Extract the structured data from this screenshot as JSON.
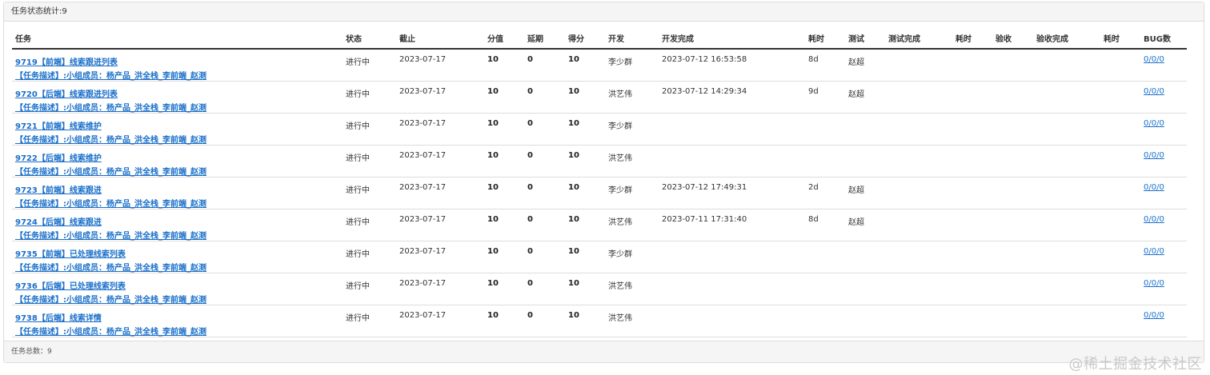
{
  "panel": {
    "header": "任务状态统计:9",
    "footer": "任务总数：9"
  },
  "table": {
    "headers": [
      "任务",
      "状态",
      "截止",
      "分值",
      "延期",
      "得分",
      "开发",
      "开发完成",
      "耗时",
      "测试",
      "测试完成",
      "耗时",
      "验收",
      "验收完成",
      "耗时",
      "BUG数"
    ],
    "rows": [
      {
        "title": "9719【前端】线索跟进列表",
        "desc": "【任务描述】:小组成员：杨产品_洪全栈_李前端_赵测",
        "status": "进行中",
        "deadline": "2023-07-17",
        "score": "10",
        "delay": "0",
        "points": "10",
        "dev": "李少群",
        "dev_done": "2023-07-12 16:53:58",
        "dev_time": "8d",
        "tester": "赵超",
        "test_done": "",
        "test_time": "",
        "accept": "",
        "accept_done": "",
        "accept_time": "",
        "bugs": "0/0/0"
      },
      {
        "title": "9720【后端】线索跟进列表",
        "desc": "【任务描述】:小组成员：杨产品_洪全栈_李前端_赵测",
        "status": "进行中",
        "deadline": "2023-07-17",
        "score": "10",
        "delay": "0",
        "points": "10",
        "dev": "洪艺伟",
        "dev_done": "2023-07-12 14:29:34",
        "dev_time": "9d",
        "tester": "赵超",
        "test_done": "",
        "test_time": "",
        "accept": "",
        "accept_done": "",
        "accept_time": "",
        "bugs": "0/0/0"
      },
      {
        "title": "9721【前端】线索维护",
        "desc": "【任务描述】:小组成员：杨产品_洪全栈_李前端_赵测",
        "status": "进行中",
        "deadline": "2023-07-17",
        "score": "10",
        "delay": "0",
        "points": "10",
        "dev": "李少群",
        "dev_done": "",
        "dev_time": "",
        "tester": "",
        "test_done": "",
        "test_time": "",
        "accept": "",
        "accept_done": "",
        "accept_time": "",
        "bugs": "0/0/0"
      },
      {
        "title": "9722【后端】线索维护",
        "desc": "【任务描述】:小组成员：杨产品_洪全栈_李前端_赵测",
        "status": "进行中",
        "deadline": "2023-07-17",
        "score": "10",
        "delay": "0",
        "points": "10",
        "dev": "洪艺伟",
        "dev_done": "",
        "dev_time": "",
        "tester": "",
        "test_done": "",
        "test_time": "",
        "accept": "",
        "accept_done": "",
        "accept_time": "",
        "bugs": "0/0/0"
      },
      {
        "title": "9723【前端】线索跟进",
        "desc": "【任务描述】:小组成员：杨产品_洪全栈_李前端_赵测",
        "status": "进行中",
        "deadline": "2023-07-17",
        "score": "10",
        "delay": "0",
        "points": "10",
        "dev": "李少群",
        "dev_done": "2023-07-12 17:49:31",
        "dev_time": "2d",
        "tester": "赵超",
        "test_done": "",
        "test_time": "",
        "accept": "",
        "accept_done": "",
        "accept_time": "",
        "bugs": "0/0/0"
      },
      {
        "title": "9724【后端】线索跟进",
        "desc": "【任务描述】:小组成员：杨产品_洪全栈_李前端_赵测",
        "status": "进行中",
        "deadline": "2023-07-17",
        "score": "10",
        "delay": "0",
        "points": "10",
        "dev": "洪艺伟",
        "dev_done": "2023-07-11 17:31:40",
        "dev_time": "8d",
        "tester": "赵超",
        "test_done": "",
        "test_time": "",
        "accept": "",
        "accept_done": "",
        "accept_time": "",
        "bugs": "0/0/0"
      },
      {
        "title": "9735【前端】已处理线索列表",
        "desc": "【任务描述】:小组成员：杨产品_洪全栈_李前端_赵测",
        "status": "进行中",
        "deadline": "2023-07-17",
        "score": "10",
        "delay": "0",
        "points": "10",
        "dev": "李少群",
        "dev_done": "",
        "dev_time": "",
        "tester": "",
        "test_done": "",
        "test_time": "",
        "accept": "",
        "accept_done": "",
        "accept_time": "",
        "bugs": "0/0/0"
      },
      {
        "title": "9736【后端】已处理线索列表",
        "desc": "【任务描述】:小组成员：杨产品_洪全栈_李前端_赵测",
        "status": "进行中",
        "deadline": "2023-07-17",
        "score": "10",
        "delay": "0",
        "points": "10",
        "dev": "洪艺伟",
        "dev_done": "",
        "dev_time": "",
        "tester": "",
        "test_done": "",
        "test_time": "",
        "accept": "",
        "accept_done": "",
        "accept_time": "",
        "bugs": "0/0/0"
      },
      {
        "title": "9738【后端】线索详情",
        "desc": "【任务描述】:小组成员：杨产品_洪全栈_李前端_赵测",
        "status": "进行中",
        "deadline": "2023-07-17",
        "score": "10",
        "delay": "0",
        "points": "10",
        "dev": "洪艺伟",
        "dev_done": "",
        "dev_time": "",
        "tester": "",
        "test_done": "",
        "test_time": "",
        "accept": "",
        "accept_done": "",
        "accept_time": "",
        "bugs": "0/0/0"
      }
    ]
  },
  "watermark": "@稀土掘金技术社区",
  "colors": {
    "link": "#1a6fc9",
    "header_bg": "#f5f5f5",
    "border": "#dddddd"
  }
}
